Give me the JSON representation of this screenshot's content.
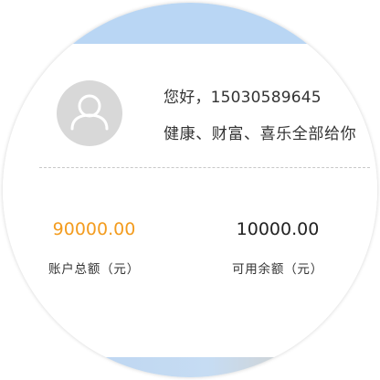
{
  "profile": {
    "greeting": "您好，15030589645",
    "slogan": "健康、财富、喜乐全部给你",
    "avatar_icon": "user-silhouette-icon"
  },
  "stats": {
    "total": {
      "value": "90000.00",
      "label": "账户总额（元）",
      "color": "#f39c1f"
    },
    "available": {
      "value": "10000.00",
      "label": "可用余额（元）",
      "color": "#222222"
    }
  },
  "theme": {
    "band_color": "#b9d6f4",
    "divider_color": "#c8c8c8"
  }
}
